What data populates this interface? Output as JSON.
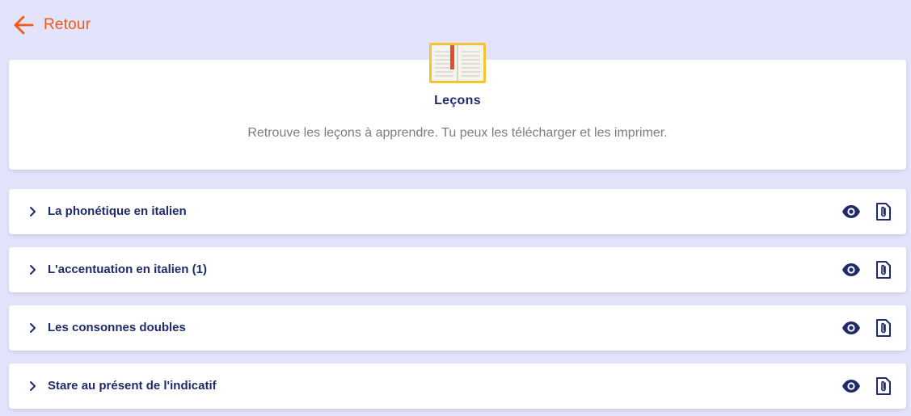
{
  "nav": {
    "back_label": "Retour",
    "back_icon": "arrow-left-icon"
  },
  "header": {
    "icon": "book-icon",
    "title": "Leçons",
    "subtitle": "Retrouve les leçons à apprendre. Tu peux les télécharger et les imprimer."
  },
  "lessons": [
    {
      "title": "La phonétique en italien"
    },
    {
      "title": "L'accentuation en italien (1)"
    },
    {
      "title": "Les consonnes doubles"
    },
    {
      "title": "Stare au présent de l'indicatif"
    }
  ],
  "row_icons": {
    "expand": "chevron-right-icon",
    "view": "eye-icon",
    "download": "paperclip-document-icon"
  },
  "colors": {
    "background": "#e3e3fb",
    "accent": "#f05a14",
    "title_text": "#1f2a6b",
    "muted_text": "#7c7c80",
    "book_frame": "#f4c430",
    "bookmark": "#e84a2a"
  }
}
